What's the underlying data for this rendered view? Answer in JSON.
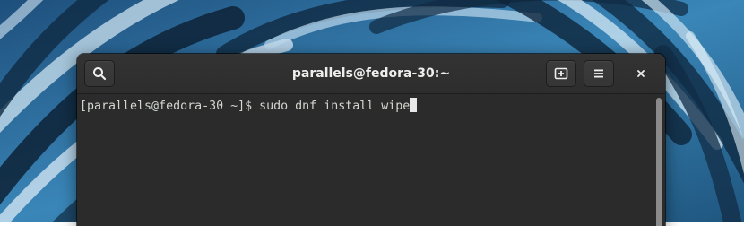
{
  "window": {
    "title": "parallels@fedora-30:~"
  },
  "headerbar": {
    "search_icon": "search-icon",
    "new_tab_icon": "new-tab-icon",
    "menu_icon": "hamburger-menu-icon",
    "close_icon": "close-icon"
  },
  "terminal": {
    "prompt": "[parallels@fedora-30 ~]$ ",
    "command": "sudo dnf install wipe"
  },
  "colors": {
    "headerbar": "#2e2e2e",
    "terminal_bg": "#2b2b2b",
    "terminal_fg": "#d3d7cf",
    "title_fg": "#eeeeec",
    "desktop_blue": "#2a6a9a"
  }
}
